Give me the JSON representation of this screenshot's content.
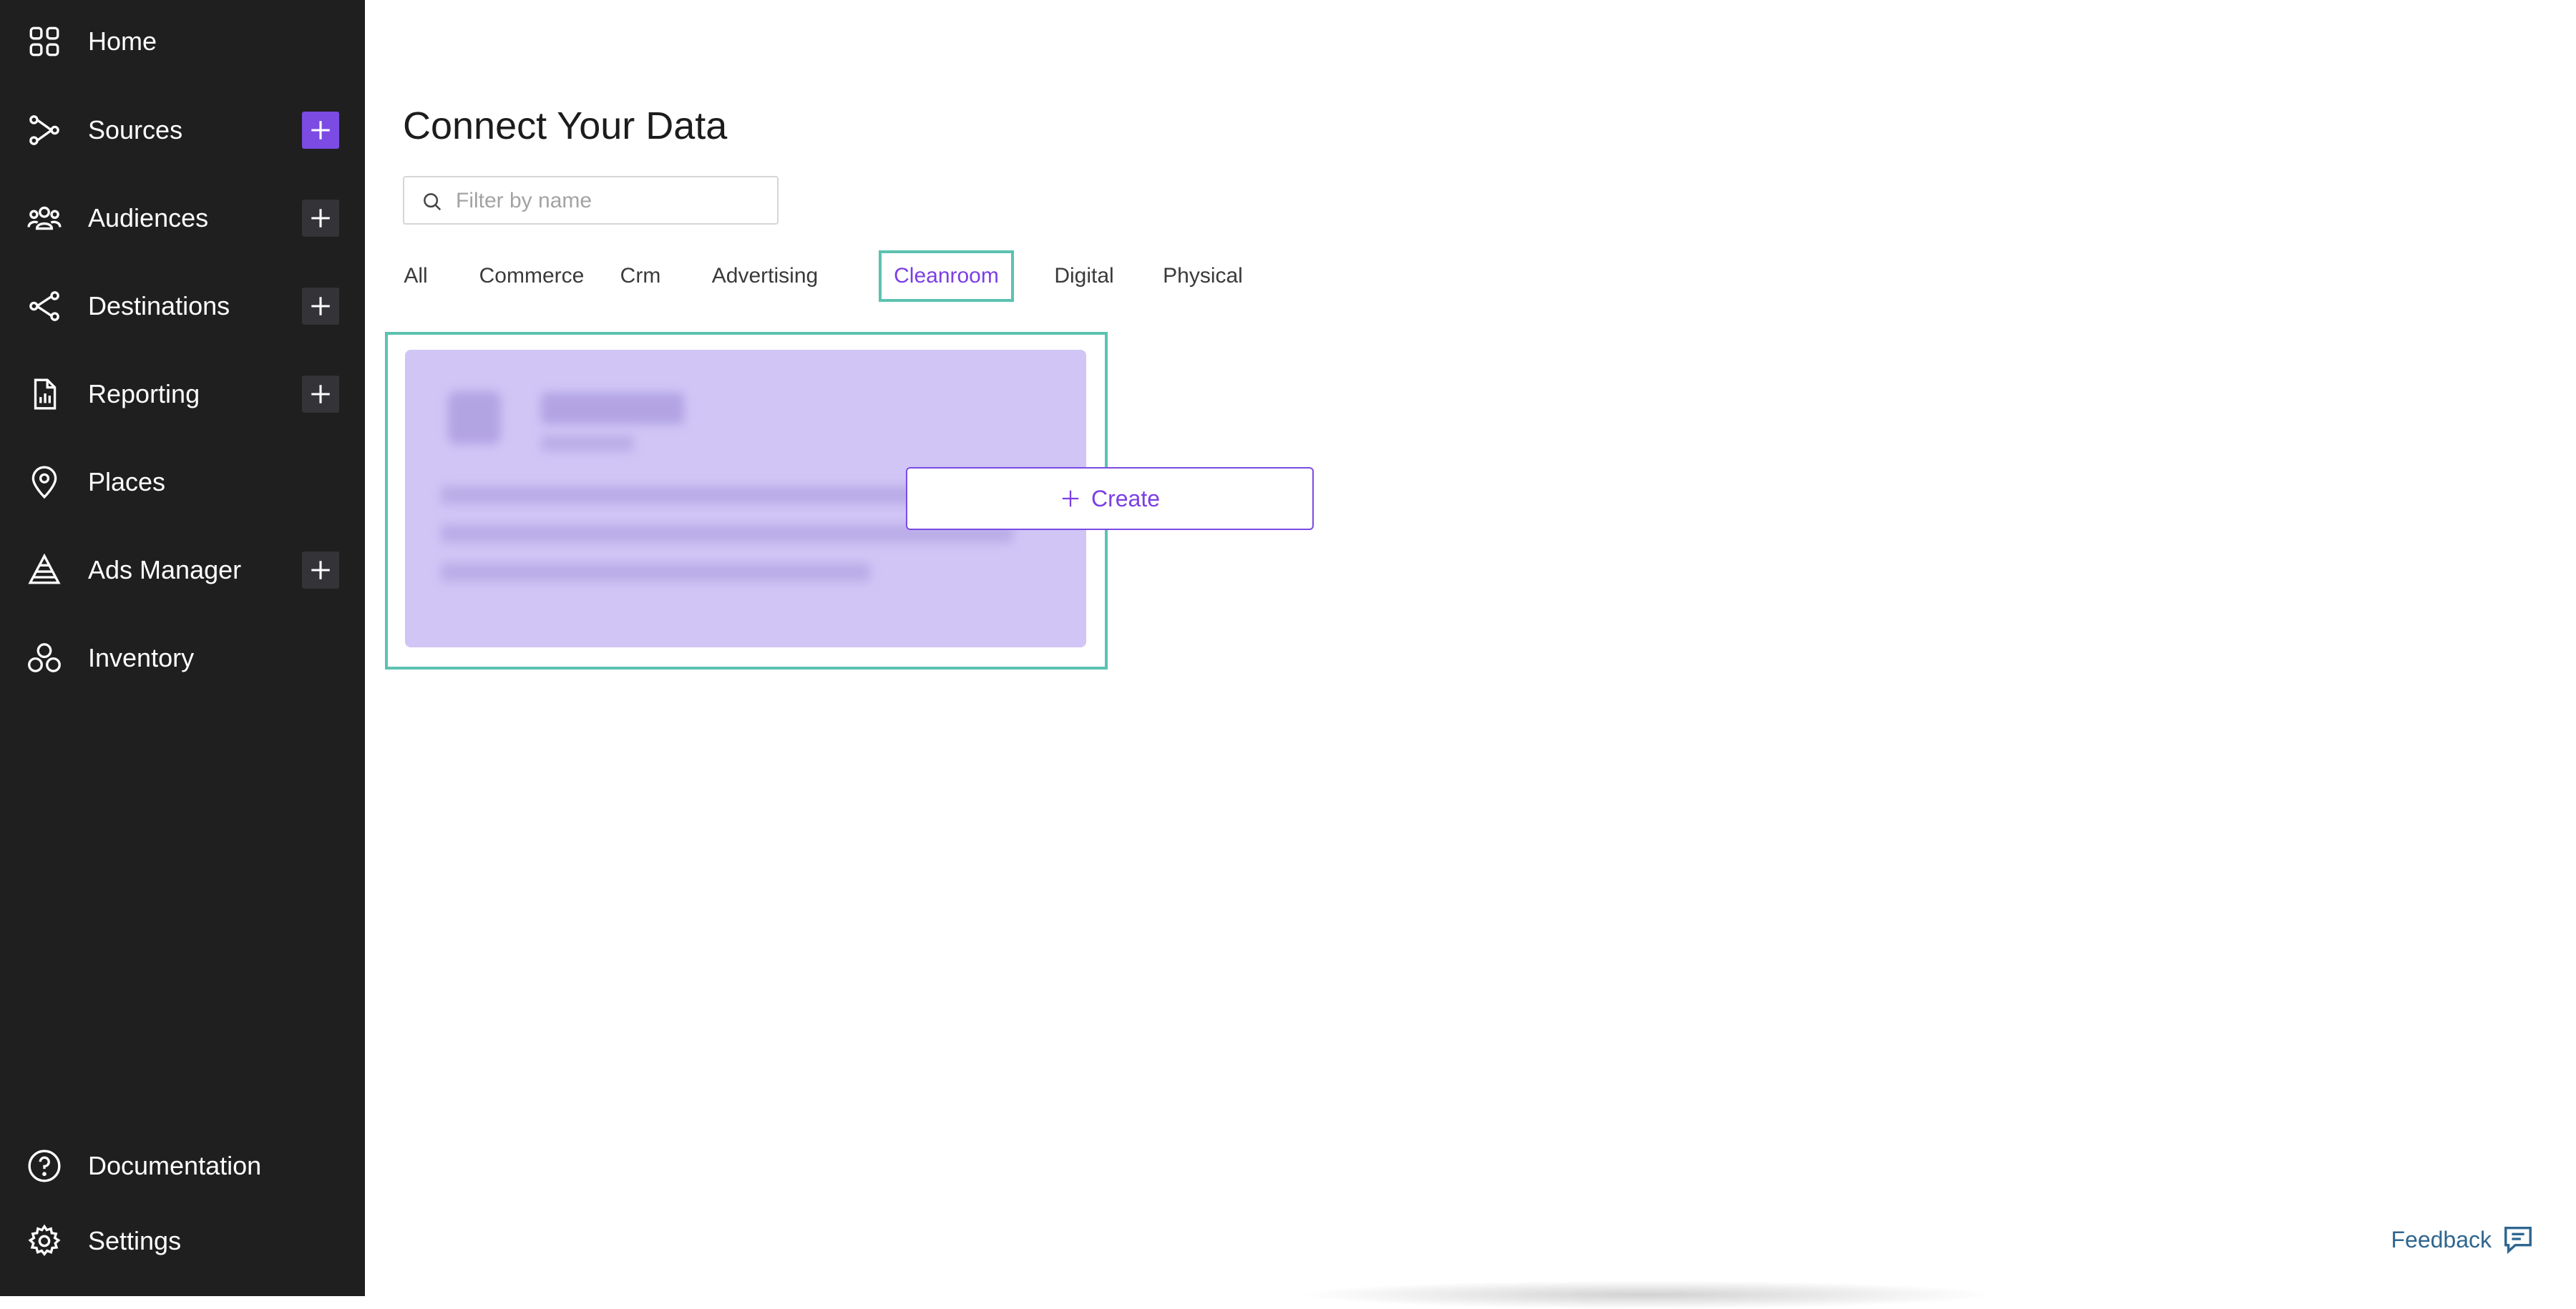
{
  "sidebar": {
    "items": [
      {
        "label": "Home",
        "icon": "grid-icon",
        "has_add": false
      },
      {
        "label": "Sources",
        "icon": "sources-icon",
        "has_add": true,
        "add_active": true
      },
      {
        "label": "Audiences",
        "icon": "audiences-icon",
        "has_add": true
      },
      {
        "label": "Destinations",
        "icon": "share-icon",
        "has_add": true
      },
      {
        "label": "Reporting",
        "icon": "report-icon",
        "has_add": true
      },
      {
        "label": "Places",
        "icon": "location-pin-icon",
        "has_add": false
      },
      {
        "label": "Ads Manager",
        "icon": "pyramid-icon",
        "has_add": true
      },
      {
        "label": "Inventory",
        "icon": "fan-icon",
        "has_add": false
      }
    ],
    "bottom_items": [
      {
        "label": "Documentation",
        "icon": "help-circle-icon"
      },
      {
        "label": "Settings",
        "icon": "gear-icon"
      }
    ]
  },
  "main": {
    "title": "Connect Your Data",
    "search": {
      "placeholder": "Filter by name",
      "value": ""
    },
    "tabs": [
      {
        "label": "All"
      },
      {
        "label": "Commerce"
      },
      {
        "label": "Crm"
      },
      {
        "label": "Advertising"
      },
      {
        "label": "Cleanroom",
        "active": true
      },
      {
        "label": "Digital"
      },
      {
        "label": "Physical"
      }
    ],
    "card": {
      "create_label": "Create"
    }
  },
  "feedback": {
    "label": "Feedback"
  },
  "colors": {
    "sidebar_bg": "#1f1f1f",
    "accent": "#7b4be3",
    "highlight": "#5cc2b0",
    "card_bg": "#d0c5f5",
    "feedback": "#2f6690"
  }
}
